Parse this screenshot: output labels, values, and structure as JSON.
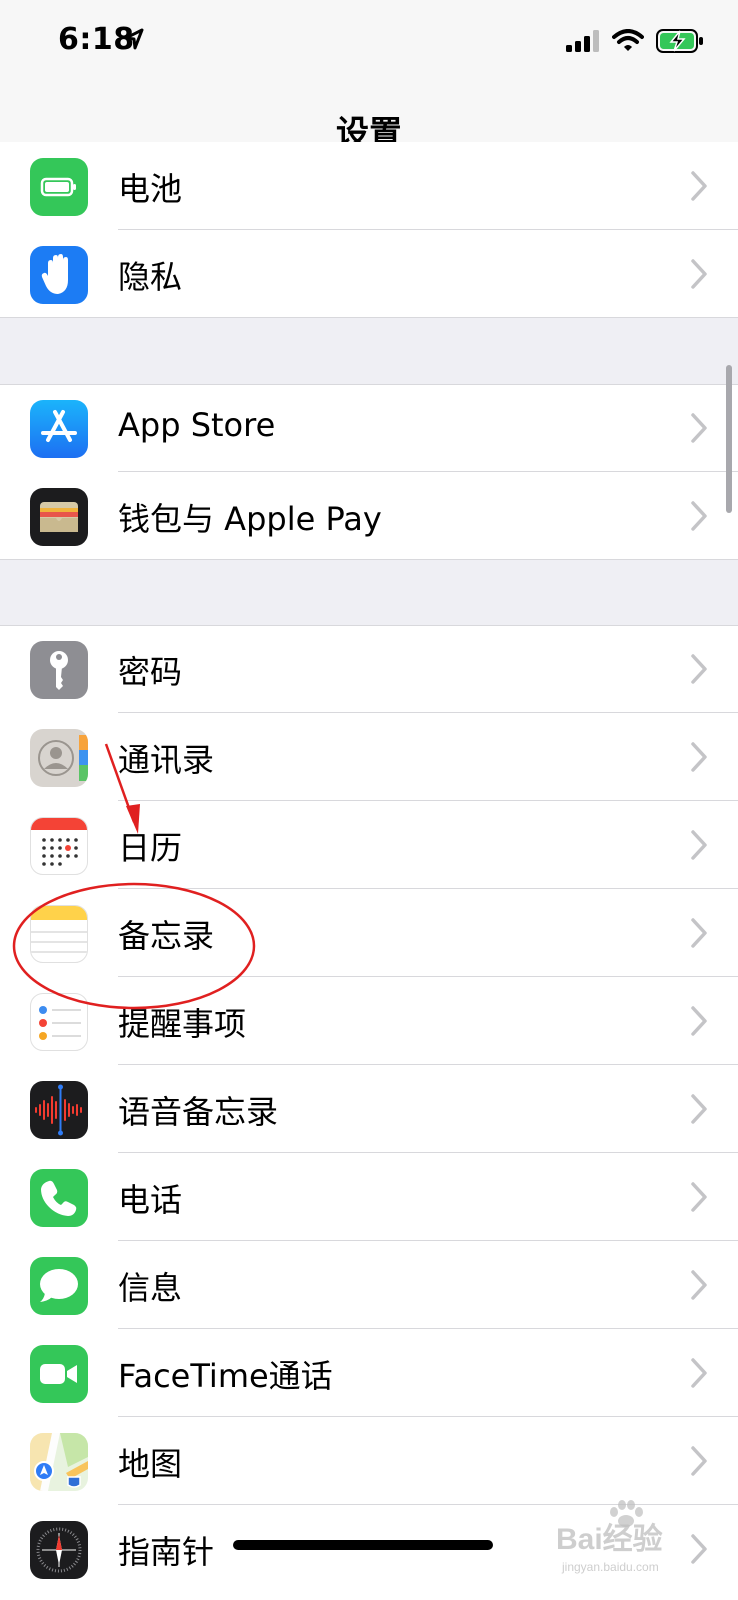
{
  "status_bar": {
    "time": "6:18"
  },
  "nav": {
    "title": "设置"
  },
  "groups": [
    {
      "items": [
        {
          "label": "电池",
          "icon": "battery-icon"
        },
        {
          "label": "隐私",
          "icon": "privacy-hand-icon"
        }
      ]
    },
    {
      "items": [
        {
          "label": "App Store",
          "icon": "app-store-icon"
        },
        {
          "label": "钱包与 Apple Pay",
          "icon": "wallet-icon"
        }
      ]
    },
    {
      "items": [
        {
          "label": "密码",
          "icon": "key-icon"
        },
        {
          "label": "通讯录",
          "icon": "contacts-icon"
        },
        {
          "label": "日历",
          "icon": "calendar-icon"
        },
        {
          "label": "备忘录",
          "icon": "notes-icon"
        },
        {
          "label": "提醒事项",
          "icon": "reminders-icon"
        },
        {
          "label": "语音备忘录",
          "icon": "voice-memos-icon"
        },
        {
          "label": "电话",
          "icon": "phone-icon"
        },
        {
          "label": "信息",
          "icon": "messages-icon"
        },
        {
          "label": "FaceTime通话",
          "icon": "facetime-icon"
        },
        {
          "label": "地图",
          "icon": "maps-icon"
        },
        {
          "label": "指南针",
          "icon": "compass-icon"
        }
      ]
    }
  ],
  "watermark": {
    "text": "Bai经验",
    "sub": "jingyan.baidu.com"
  },
  "colors": {
    "accent_annotation": "#e02020",
    "chevron": "#c4c4c7",
    "green": "#34c759",
    "blue": "#1c7cf4"
  }
}
